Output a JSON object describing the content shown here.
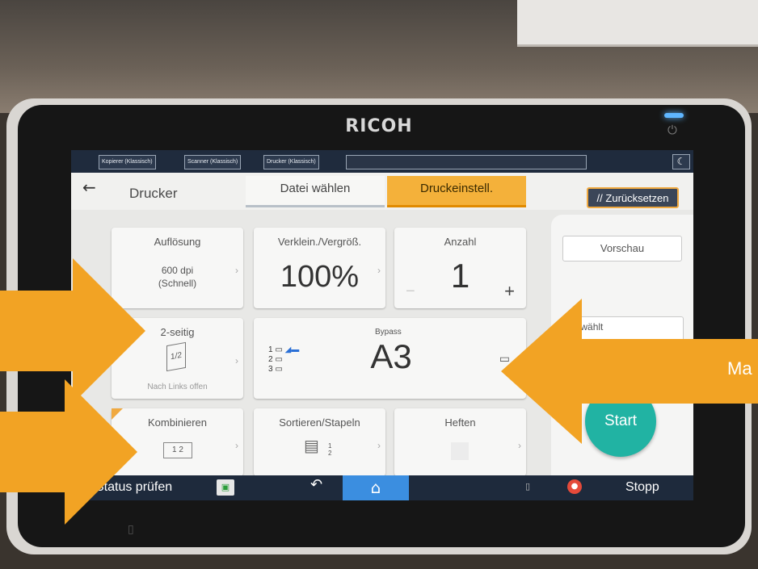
{
  "device": {
    "brand": "RICOH"
  },
  "topbar": {
    "app_tabs": [
      "Kopierer (Klassisch)",
      "Scanner (Klassisch)",
      "Drucker (Klassisch)"
    ],
    "moon_icon": "moon-icon"
  },
  "header": {
    "back_icon": "←",
    "title": "Drucker",
    "tabs": [
      {
        "label": "Datei wählen",
        "active": false
      },
      {
        "label": "Druckeinstell.",
        "active": true
      }
    ],
    "reset_label": "Zurücksetzen",
    "reset_icon": "//"
  },
  "settings": {
    "resolution": {
      "label": "Auflösung",
      "value": "600 dpi",
      "sub": "(Schnell)"
    },
    "scale": {
      "label": "Verklein./Vergröß.",
      "value": "100%"
    },
    "quantity": {
      "label": "Anzahl",
      "value": "1",
      "minus": "−",
      "plus": "+"
    },
    "duplex": {
      "label": "2-seitig",
      "sub": "Nach Links offen"
    },
    "paper": {
      "label": "Bypass",
      "value": "A3",
      "trays": [
        "1",
        "2",
        "3"
      ]
    },
    "combine": {
      "label": "Kombinieren",
      "value": "1 2"
    },
    "sort": {
      "label": "Sortieren/Stapeln",
      "pages": [
        "1",
        "2"
      ]
    },
    "staple": {
      "label": "Heften"
    }
  },
  "side": {
    "preview_label": "Vorschau",
    "selected_label": "gewählt",
    "start_label": "Start"
  },
  "statusbar": {
    "status_label": "Status prüfen",
    "undo_icon": "↶",
    "home_icon": "⌂",
    "stop_label": "Stopp"
  },
  "overlay": {
    "partial_text": "Ma",
    "arrow_color": "#f2a324"
  }
}
